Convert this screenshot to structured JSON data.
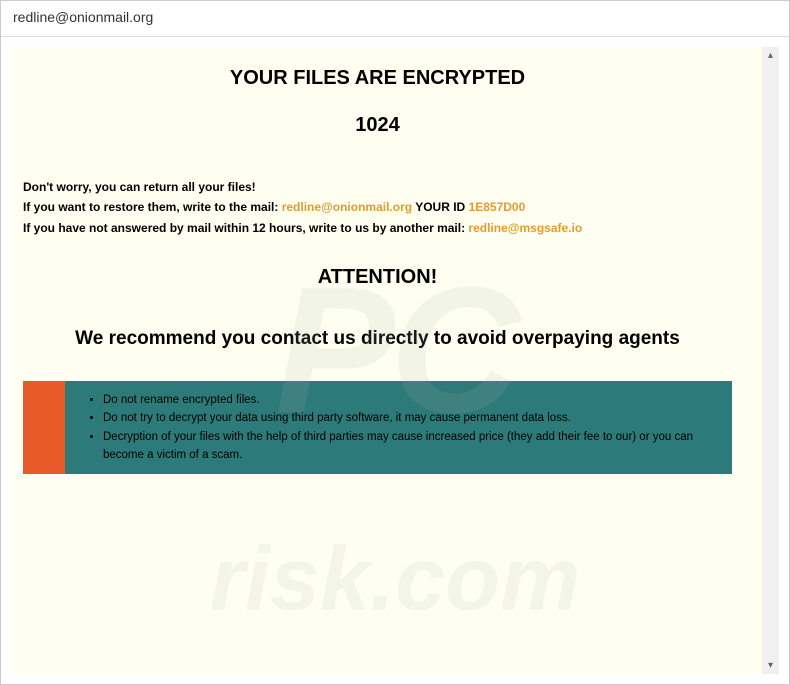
{
  "titlebar": "redline@onionmail.org",
  "main_title": "YOUR FILES ARE ENCRYPTED",
  "sub_number": "1024",
  "info": {
    "line1": "Don't worry, you can return all your files!",
    "line2_prefix": "If you want to restore them, write to the mail:   ",
    "email1": "redline@onionmail.org",
    "your_id_label": "   YOUR ID ",
    "your_id": "1E857D00",
    "line3_prefix": "If you have not answered by mail within 12 hours, write to us by another mail:   ",
    "email2": "redline@msgsafe.io"
  },
  "attention": "ATTENTION!",
  "recommend": "We recommend you contact us directly to avoid overpaying agents",
  "warnings": {
    "item1": "Do not rename encrypted files.",
    "item2": "Do not try to decrypt your data using third party software, it may cause permanent data loss.",
    "item3": "Decryption of your files with the help of third parties may cause increased price (they add their fee to our) or you can become a victim of a scam."
  },
  "watermark_main": "PC",
  "watermark_sub": "risk.com"
}
